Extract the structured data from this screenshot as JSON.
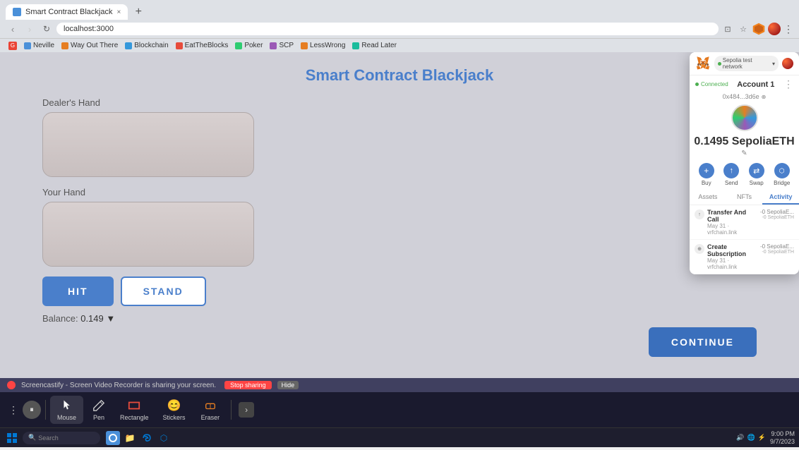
{
  "browser": {
    "tab": {
      "title": "Smart Contract Blackjack",
      "favicon_color": "#4a90d9"
    },
    "address": "localhost:3000",
    "bookmarks": [
      {
        "label": "G",
        "color": "#ea4335"
      },
      {
        "label": "Neville",
        "color": "#4a90d9"
      },
      {
        "label": "Way Out There",
        "color": "#e67e22"
      },
      {
        "label": "Blockchain",
        "color": "#3498db"
      },
      {
        "label": "EatTheBlocks",
        "color": "#e74c3c"
      },
      {
        "label": "Poker",
        "color": "#2ecc71"
      },
      {
        "label": "SCP",
        "color": "#9b59b6"
      },
      {
        "label": "LessWrong",
        "color": "#e67e22"
      },
      {
        "label": "Read Later",
        "color": "#1abc9c"
      }
    ]
  },
  "game": {
    "title": "Smart Contract Blackjack",
    "dealer_hand_label": "Dealer's Hand",
    "your_hand_label": "Your Hand",
    "hit_button": "HIT",
    "stand_button": "STAND",
    "continue_button": "CONTINUE",
    "balance_label": "Balance:",
    "balance_value": "0.149 ▼"
  },
  "metamask": {
    "network_label": "Sepolia test network",
    "connected_label": "Connected",
    "account_name": "Account 1",
    "account_address": "0x484...3d6e",
    "balance": "0.1495 SepoliaETH",
    "edit_icon": "✎",
    "tabs": [
      "Assets",
      "NFTs",
      "Activity"
    ],
    "active_tab": "Activity",
    "actions": [
      {
        "label": "Buy",
        "icon": "+"
      },
      {
        "label": "Send",
        "icon": "↑"
      },
      {
        "label": "Swap",
        "icon": "⇄"
      },
      {
        "label": "Bridge",
        "icon": "⬡"
      }
    ],
    "activities": [
      {
        "name": "Transfer And Call",
        "date": "May 31 · vrfchain.link",
        "amount": "-0 SepoliaE...",
        "amount2": "-0 SepoliaETH"
      },
      {
        "name": "Create Subscription",
        "date": "May 31 · vrfchain.link",
        "amount": "-0 SepoliaE...",
        "amount2": "-0 SepoliaETH"
      }
    ]
  },
  "toolbar": {
    "tools": [
      {
        "label": "Mouse",
        "active": true
      },
      {
        "label": "Pen",
        "active": false
      },
      {
        "label": "Rectangle",
        "active": false
      },
      {
        "label": "Stickers",
        "active": false
      },
      {
        "label": "Eraser",
        "active": false
      }
    ]
  },
  "screencast": {
    "message": "Screencastify - Screen Video Recorder is sharing your screen.",
    "stop_label": "Stop sharing",
    "hide_label": "Hide"
  },
  "taskbar": {
    "time": "9:00 PM",
    "date": "9/7/2023"
  }
}
